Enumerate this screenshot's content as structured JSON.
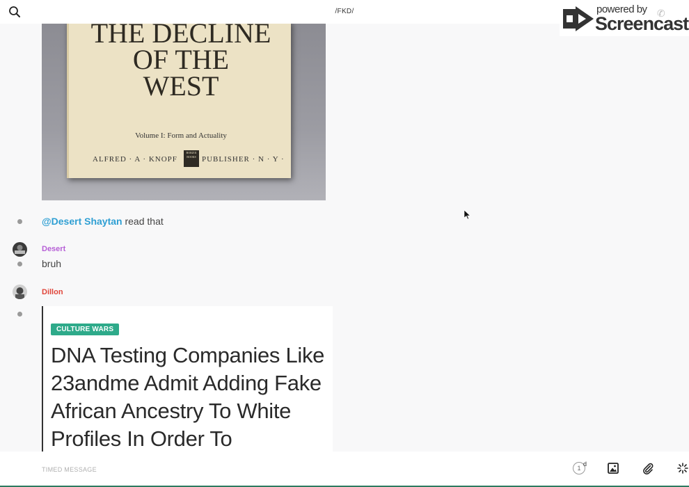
{
  "header": {
    "title": "/FKD/",
    "search_icon": "search-icon"
  },
  "watermark": {
    "small_text": "powered by",
    "brand": "Screencastify"
  },
  "book_image": {
    "title_lines": [
      "THE DECLINE",
      "OF THE",
      "WEST"
    ],
    "volume": "Volume I: Form and Actuality",
    "publisher_left": "ALFRED · A · KNOPF",
    "publisher_right": "PUBLISHER · N · Y ·",
    "borzoi": "BORZOI BOOKS"
  },
  "messages": [
    {
      "mention": "@Desert Shaytan",
      "text": " read that"
    },
    {
      "sender": "Desert",
      "sender_color": "#b65fd6",
      "text": "bruh"
    },
    {
      "sender": "Dillon",
      "sender_color": "#e0453a"
    }
  ],
  "article": {
    "tag": "CULTURE WARS",
    "headline": "DNA Testing Companies Like 23andme Admit Adding Fake African Ancestry To White Profiles In Order To"
  },
  "composer": {
    "placeholder": "TIMED MESSAGE",
    "timer_value": "1",
    "timer_unit": "d"
  },
  "icons": {
    "image": "image-icon",
    "attach": "paperclip-icon",
    "more": "spinner-icon"
  }
}
